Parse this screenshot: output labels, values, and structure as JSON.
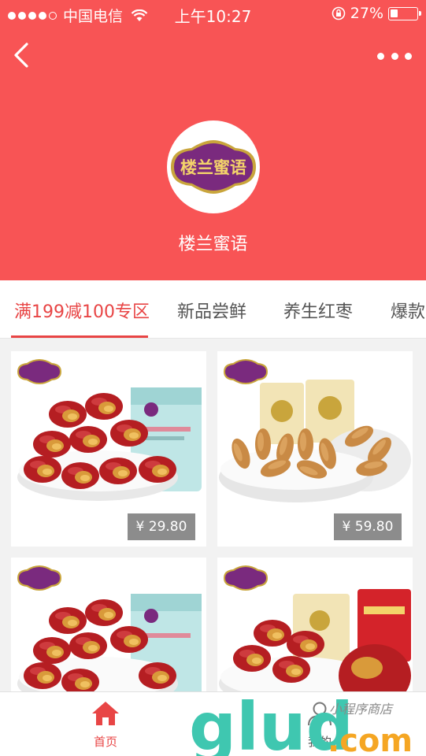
{
  "status_bar": {
    "carrier": "中国电信",
    "time": "上午10:27",
    "battery": "27%",
    "battery_level": 0.27
  },
  "shop": {
    "name": "楼兰蜜语",
    "logo_text": "楼兰蜜语"
  },
  "tabs": [
    {
      "label": "满199减100专区",
      "active": true
    },
    {
      "label": "新品尝鲜",
      "active": false
    },
    {
      "label": "养生红枣",
      "active": false
    },
    {
      "label": "爆款",
      "active": false
    }
  ],
  "products": [
    {
      "price": "¥ 29.80",
      "image": "red-dates-walnut",
      "badge": "楼兰蜜语"
    },
    {
      "price": "¥ 59.80",
      "image": "almonds",
      "badge": "楼兰蜜语"
    },
    {
      "price": "",
      "image": "red-dates-walnut",
      "badge": "楼兰蜜语"
    },
    {
      "price": "",
      "image": "dates-mix-bags",
      "badge": "楼兰蜜语"
    }
  ],
  "tab_bar": {
    "home_label": "首页",
    "mine_label": "我的"
  },
  "watermark": {
    "text": "glud",
    "suffix": ".com",
    "tagline": "小程序商店"
  },
  "colors": {
    "header_bg": "#f85455",
    "accent": "#e84545",
    "price_bg": "#8c8c8c"
  }
}
